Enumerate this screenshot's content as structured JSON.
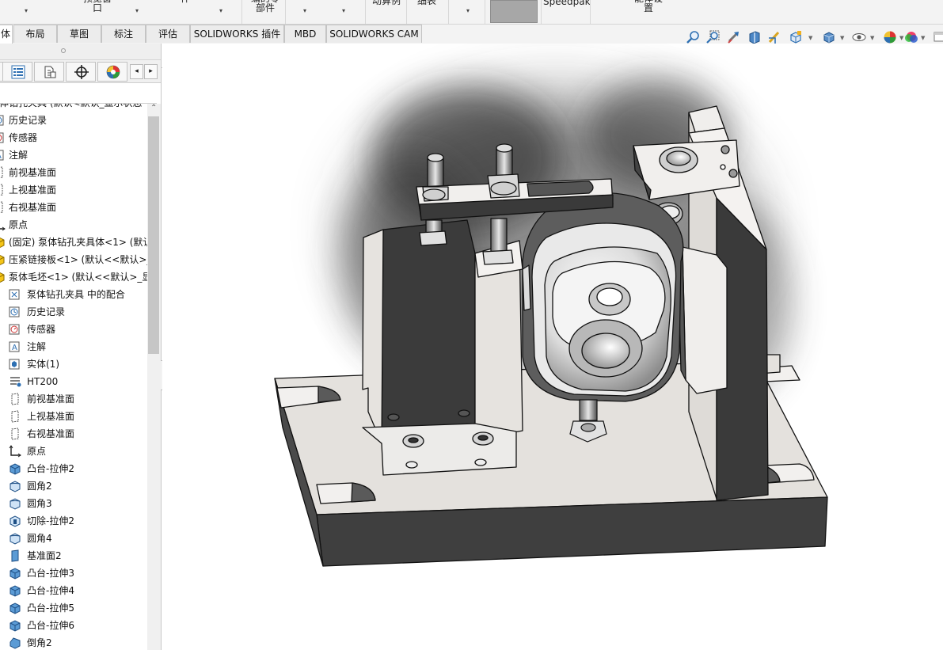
{
  "ribbon": {
    "partial_labels": [
      "件",
      "预览窗\n口",
      "件",
      "编的零\n部件",
      "动算例",
      "细表",
      "Speedpak",
      "能体设\n置"
    ],
    "swatch_color": "#a7a7a7"
  },
  "tabs": [
    {
      "label": "体",
      "active": true
    },
    {
      "label": "布局"
    },
    {
      "label": "草图"
    },
    {
      "label": "标注"
    },
    {
      "label": "评估"
    },
    {
      "label": "SOLIDWORKS 插件"
    },
    {
      "label": "MBD"
    },
    {
      "label": "SOLIDWORKS CAM"
    }
  ],
  "heads_up_toolbar": {
    "icons": [
      "zoom-to-fit-icon",
      "zoom-to-area-icon",
      "previous-view-icon",
      "section-view-icon",
      "dynamic-annotation-icon",
      "view-orientation-icon",
      "display-style-icon",
      "hide-show-items-icon",
      "edit-appearance-icon",
      "apply-scene-icon",
      "view-settings-icon"
    ]
  },
  "panel": {
    "tab_icons": [
      "feature-manager-icon",
      "property-manager-icon",
      "configuration-manager-icon",
      "dimxpert-icon",
      "display-manager-icon"
    ]
  },
  "tree": {
    "items": [
      {
        "label": "体钻孔夹具  (默认<默认_显示状态-",
        "icon": "assembly-icon"
      },
      {
        "label": "历史记录",
        "icon": "history-icon"
      },
      {
        "label": "传感器",
        "icon": "sensor-icon"
      },
      {
        "label": "注解",
        "icon": "annotations-icon"
      },
      {
        "label": "前视基准面",
        "icon": "plane-icon"
      },
      {
        "label": "上视基准面",
        "icon": "plane-icon"
      },
      {
        "label": "右视基准面",
        "icon": "plane-icon"
      },
      {
        "label": "原点",
        "icon": "origin-icon"
      },
      {
        "label": "(固定) 泵体钻孔夹具体<1> (默认",
        "icon": "part-icon"
      },
      {
        "label": "压紧链接板<1> (默认<<默认>_",
        "icon": "part-icon"
      },
      {
        "label": "泵体毛坯<1> (默认<<默认>_显",
        "icon": "part-icon"
      },
      {
        "label": "泵体钻孔夹具 中的配合",
        "icon": "mates-icon"
      },
      {
        "label": "历史记录",
        "icon": "history-icon"
      },
      {
        "label": "传感器",
        "icon": "sensor-icon"
      },
      {
        "label": "注解",
        "icon": "annotations-icon"
      },
      {
        "label": "实体(1)",
        "icon": "solid-bodies-icon"
      },
      {
        "label": "HT200",
        "icon": "material-icon"
      },
      {
        "label": "前视基准面",
        "icon": "plane-icon"
      },
      {
        "label": "上视基准面",
        "icon": "plane-icon"
      },
      {
        "label": "右视基准面",
        "icon": "plane-icon"
      },
      {
        "label": "原点",
        "icon": "origin-icon"
      },
      {
        "label": "凸台-拉伸2",
        "icon": "boss-extrude-icon"
      },
      {
        "label": "圆角2",
        "icon": "fillet-icon"
      },
      {
        "label": "圆角3",
        "icon": "fillet-icon"
      },
      {
        "label": "切除-拉伸2",
        "icon": "cut-extrude-icon"
      },
      {
        "label": "圆角4",
        "icon": "fillet-icon"
      },
      {
        "label": "基准面2",
        "icon": "ref-plane-icon"
      },
      {
        "label": "凸台-拉伸3",
        "icon": "boss-extrude-icon"
      },
      {
        "label": "凸台-拉伸4",
        "icon": "boss-extrude-icon"
      },
      {
        "label": "凸台-拉伸5",
        "icon": "boss-extrude-icon"
      },
      {
        "label": "凸台-拉伸6",
        "icon": "boss-extrude-icon"
      },
      {
        "label": "倒角2",
        "icon": "chamfer-icon"
      }
    ]
  }
}
